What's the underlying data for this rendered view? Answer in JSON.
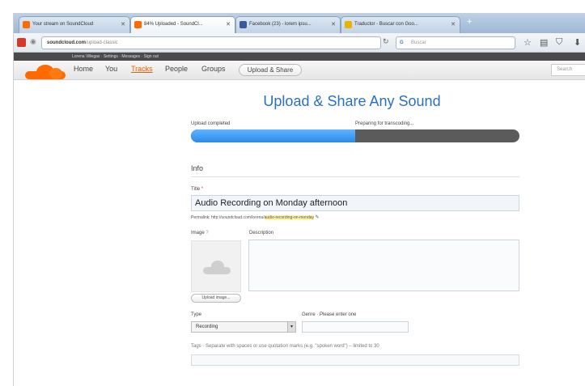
{
  "browser": {
    "tabs": [
      {
        "label": "Your stream on SoundCloud",
        "favicon_color": "#ff6a00"
      },
      {
        "label": "84% Uploaded - SoundCl...",
        "favicon_color": "#ff6a00",
        "active": true
      },
      {
        "label": "Facebook (23) - lorem ipsu...",
        "favicon_color": "#3b5998"
      },
      {
        "label": "Traductor - Buscar con Goo...",
        "favicon_color": "#e8b400"
      }
    ],
    "new_tab": "+",
    "url_host": "soundcloud.com",
    "url_path": "/upload-classic",
    "search_placeholder": "Buscar"
  },
  "soundcloud": {
    "user_bar": "Lorena Villegas · Settings · Messages · Sign out",
    "nav": [
      {
        "label": "Home",
        "active": false
      },
      {
        "label": "You",
        "active": false
      },
      {
        "label": "Tracks",
        "active": true
      },
      {
        "label": "People",
        "active": false
      },
      {
        "label": "Groups",
        "active": false
      }
    ],
    "upload_button": "Upload & Share",
    "search_placeholder": "Search"
  },
  "upload": {
    "page_title": "Upload & Share Any Sound",
    "progress_left_label": "Upload completed",
    "progress_right_label": "Preparing for transcoding...",
    "progress_fraction": 0.5,
    "info_heading": "Info",
    "title_label": "Title",
    "title_required_mark": "*",
    "title_value": "Audio Recording on Monday afternoon",
    "permalink_prefix": "Permalink: http://soundcloud.com/lorena/",
    "permalink_slug": "audio-recording-on-monday",
    "image_label": "Image",
    "image_help": "?",
    "description_label": "Description",
    "upload_image_button": "Upload image...",
    "type_label": "Type",
    "type_value": "Recording",
    "genre_label": "Genre · Please enter one",
    "tags_label": "Tags · Separate with spaces or use quotation marks (e.g. \"spoken word\") – limited to 30"
  },
  "colors": {
    "accent_blue": "#2a6fc9",
    "progress_blue": "#2c8ae8",
    "progress_gray": "#5b5b5b",
    "brand_orange": "#ff6a00"
  }
}
